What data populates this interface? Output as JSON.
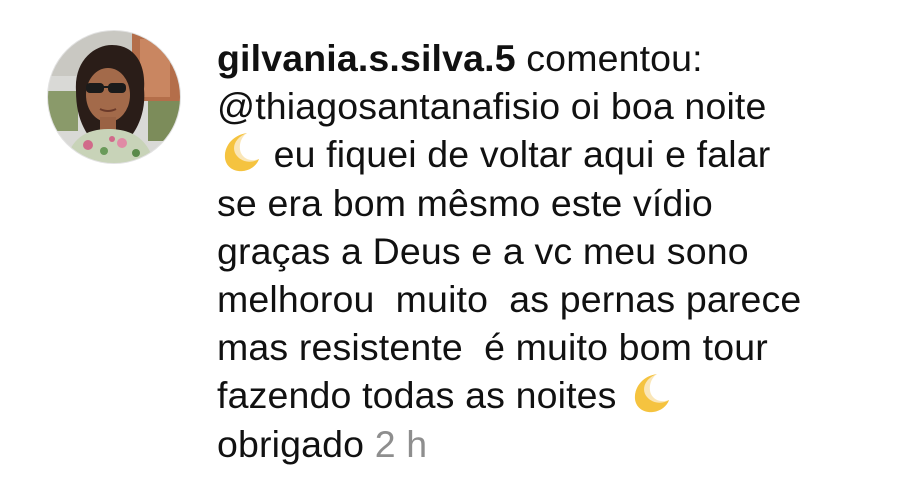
{
  "comment": {
    "author": "gilvania.s.silva.5",
    "action": " comentou:",
    "text_lines": [
      "@thiagosantanafisio oi boa noite",
      " eu fiquei de voltar aqui e falar",
      "se era bom mêsmo este vídio",
      "graças a Deus e a vc meu sono",
      "melhorou  muito  as pernas parece",
      "mas resistente  é muito bom tour",
      "fazendo todas as noites ",
      "obrigado "
    ],
    "timestamp": "2 h",
    "emoji": "crescent-moon"
  },
  "colors": {
    "text": "#111111",
    "timestamp": "#8e8e8e",
    "moon": "#f7c948",
    "background": "#ffffff"
  }
}
